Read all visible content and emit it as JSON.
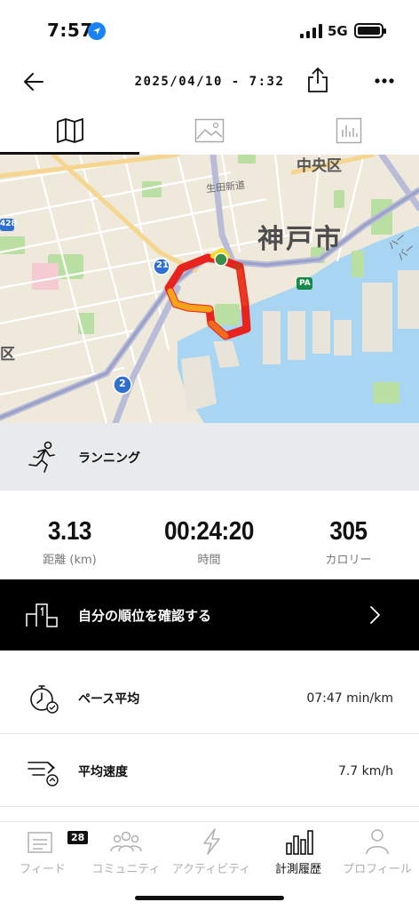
{
  "status_bar": {
    "time": "7:57",
    "network": "5G"
  },
  "header": {
    "title": "2025/04/10 - 7:32",
    "icons": [
      "back-arrow-icon",
      "share-icon",
      "more-icon"
    ]
  },
  "tabs": [
    {
      "icon": "map-icon",
      "selected": true
    },
    {
      "icon": "image-icon",
      "selected": false
    },
    {
      "icon": "chart-icon",
      "selected": false
    }
  ],
  "map": {
    "labels": {
      "chuo_ku": "中央区",
      "kobe_shi": "神戸市",
      "ikuta": "生田新道",
      "pa": "PA",
      "route_21": "21",
      "route_2": "2",
      "route_428": "428",
      "ku": "区",
      "highway": "ハーバー"
    },
    "route_colors": [
      "#e8231e",
      "#f26b1d",
      "#f7b21b",
      "#fadc23"
    ]
  },
  "activity": {
    "type": "ランニング",
    "icon": "runner-icon"
  },
  "stats": [
    {
      "value": "3.13",
      "label": "距離 (km)"
    },
    {
      "value": "00:24:20",
      "label": "時間"
    },
    {
      "value": "305",
      "label": "カロリー"
    }
  ],
  "rank_banner": {
    "label": "自分の順位を確認する",
    "icon": "podium-icon"
  },
  "metrics": [
    {
      "label": "ペース平均",
      "value": "07:47 min/km",
      "icon": "pace-icon"
    },
    {
      "label": "平均速度",
      "value": "7.7 km/h",
      "icon": "speed-icon"
    }
  ],
  "bottom_nav": [
    {
      "label": "フィード",
      "badge": "28",
      "icon": "feed-icon",
      "active": false
    },
    {
      "label": "コミュニティ",
      "icon": "community-icon",
      "active": false
    },
    {
      "label": "アクティビティ",
      "icon": "activity-bolt-icon",
      "active": false
    },
    {
      "label": "計測履歴",
      "icon": "bar-chart-icon",
      "active": true
    },
    {
      "label": "プロフィール",
      "icon": "person-icon",
      "active": false
    }
  ]
}
